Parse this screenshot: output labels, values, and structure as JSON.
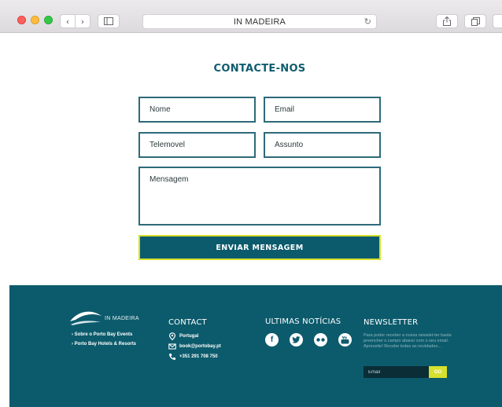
{
  "browser": {
    "address": "IN MADEIRA",
    "icons": {
      "back": "chevron-left-icon",
      "forward": "chevron-right-icon",
      "sidebar": "sidebar-icon",
      "reload": "reload-icon",
      "share": "share-icon",
      "tabs": "tabs-icon"
    }
  },
  "contact_form": {
    "title": "CONTACTE-NOS",
    "fields": {
      "name_placeholder": "Nome",
      "email_placeholder": "Email",
      "phone_placeholder": "Telemovel",
      "subject_placeholder": "Assunto",
      "message_placeholder": "Mensagem"
    },
    "submit_label": "ENVIAR MENSAGEM"
  },
  "footer": {
    "logo_text": "IN MADEIRA",
    "about_links": [
      "Sobre o Porto Bay Events",
      "Porto Bay Hotels & Resorts"
    ],
    "contact": {
      "title": "CONTACT",
      "location": "Portugal",
      "email": "book@portobay.pt",
      "phone": "+351 291 708 750"
    },
    "news": {
      "title": "ULTIMAS NOTÍCIAS",
      "social_icons": [
        "facebook-icon",
        "twitter-icon",
        "flickr-icon",
        "youtube-icon"
      ]
    },
    "newsletter": {
      "title": "NEWSLETTER",
      "description": "Para poder receber a nossa newslet-ter basta preencher o campo abaixo com o seu email. Aproveite! Recebe todas as novidades...",
      "input_placeholder": "Email",
      "button_label": "GO"
    }
  },
  "colors": {
    "brand": "#0c5b6c",
    "accent": "#d7e02d",
    "title": "#0f5c6e"
  }
}
